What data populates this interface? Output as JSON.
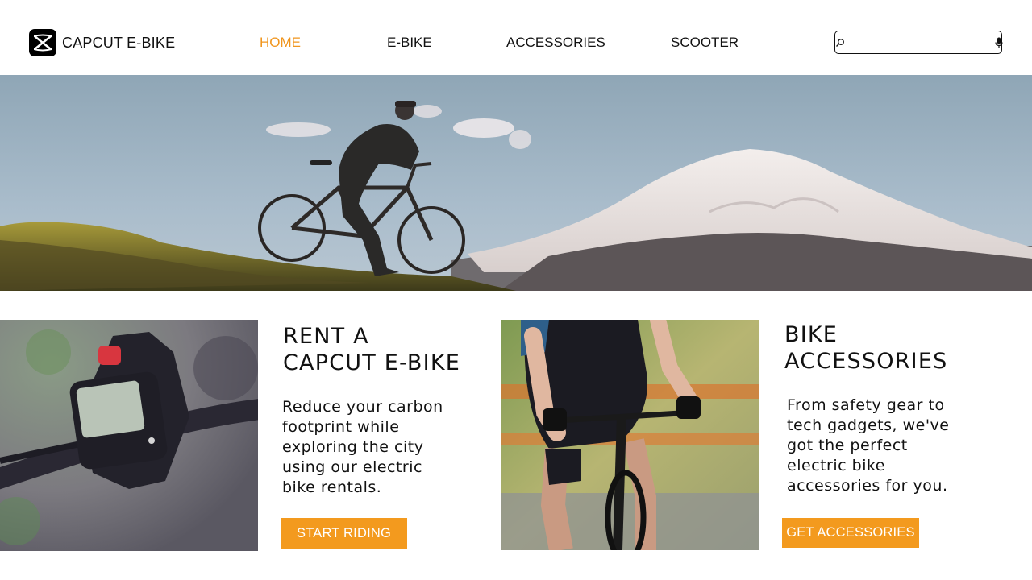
{
  "brand": {
    "name": "CAPCUT E-BIKE",
    "logo_icon": "capcut-logo-icon"
  },
  "nav": {
    "items": [
      {
        "label": "HOME",
        "active": true
      },
      {
        "label": "E-BIKE",
        "active": false
      },
      {
        "label": "ACCESSORIES",
        "active": false
      },
      {
        "label": "SCOOTER",
        "active": false
      }
    ]
  },
  "search": {
    "value": "",
    "placeholder": "",
    "search_icon": "search-icon",
    "mic_icon": "microphone-icon"
  },
  "hero": {
    "image": "cyclist-on-ridge-with-snowy-mountain-photo"
  },
  "cards": [
    {
      "image": "ebike-handlebar-display-photo",
      "title_line1": "RENT A",
      "title_line2": "CAPCUT E-BIKE",
      "body_lines": [
        "Reduce your carbon",
        "footprint while",
        "exploring the city",
        "using our electric",
        "bike rentals."
      ],
      "button": "START RIDING"
    },
    {
      "image": "cyclist-riding-road-bike-photo",
      "title_line1": "BIKE",
      "title_line2": "ACCESSORIES",
      "body_lines": [
        "From safety gear to",
        "tech gadgets, we've",
        "got the perfect",
        "electric bike",
        "accessories for you."
      ],
      "button": "GET ACCESSORIES"
    }
  ],
  "colors": {
    "accent": "#f39a1e",
    "active_nav": "#f0951d",
    "text": "#111111",
    "background": "#ffffff"
  }
}
